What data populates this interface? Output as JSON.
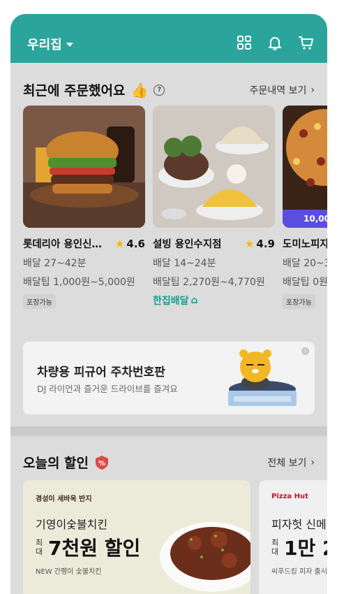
{
  "header": {
    "location": "우리집",
    "icons": [
      "grid-icon",
      "bell-icon",
      "cart-icon"
    ],
    "color": "#2ba59b"
  },
  "recent": {
    "title": "최근에 주문했어요",
    "link": "주문내역 보기",
    "cards": [
      {
        "name": "롯데리아 용인신…",
        "rating": "4.6",
        "delivery": "배달 27~42분",
        "tip": "배달팁 1,000원~5,000원",
        "tag": "포장가능"
      },
      {
        "name": "설빙 용인수지점",
        "rating": "4.9",
        "delivery": "배달 14~24분",
        "tip": "배달팁 2,270원~4,770원",
        "hanjip": "한집배달"
      },
      {
        "name": "도미노피자",
        "delivery": "배달 20~3",
        "tip": "배달팁 0원",
        "tag": "포장가능",
        "promo": "10,00"
      }
    ]
  },
  "banner": {
    "title": "차량용 피규어 주차번호판",
    "subtitle": "DJ 라이언과 즐거운 드라이브를 즐겨요",
    "info": "i"
  },
  "discount": {
    "title": "오늘의 할인",
    "link": "전체 보기",
    "deals": [
      {
        "logo": "경성이 세바옥 반지",
        "name": "기영이숯불치킨",
        "small": "최대",
        "amount": "7천원 할인",
        "note": "NEW 간펭이 숯불치킨"
      },
      {
        "logo": "Pizza Hut",
        "name": "피자헛 신메",
        "small": "최대",
        "amount": "1만 2",
        "note": "씨푸드킹 피자 출시"
      }
    ]
  }
}
